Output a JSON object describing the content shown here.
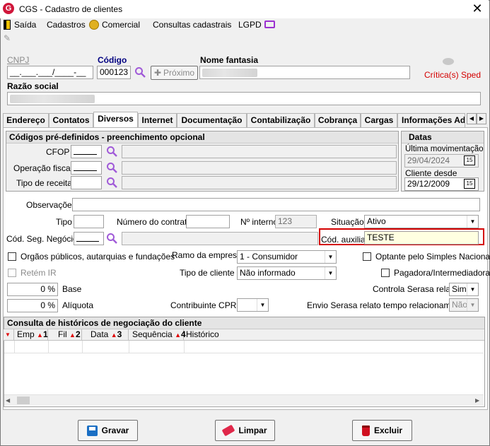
{
  "window": {
    "title": "CGS - Cadastro de clientes",
    "close": "✕"
  },
  "menu": {
    "saida": "Saída",
    "cadastros": "Cadastros",
    "comercial": "Comercial",
    "consultas": "Consultas cadastrais",
    "lgpd": "LGPD"
  },
  "header": {
    "cnpj_label": "CNPJ",
    "cnpj_value": "__.___.___/____-__",
    "codigo_label": "Código",
    "codigo_value": "000123",
    "proximo_label": "Próximo",
    "nome_fantasia_label": "Nome fantasia",
    "criticas_label": "Crítica(s) Sped",
    "razao_social_label": "Razão social"
  },
  "tabs": [
    "Endereço",
    "Contatos",
    "Diversos",
    "Internet",
    "Documentação",
    "Contabilização",
    "Cobrança",
    "Cargas",
    "Informações Adi"
  ],
  "codigos": {
    "title": "Códigos pré-definidos - preenchimento opcional",
    "cfop": "CFOP",
    "operacao": "Operação fiscal",
    "tipo_receita": "Tipo de receita"
  },
  "datas": {
    "title": "Datas",
    "ultima_label": "Última movimentação",
    "ultima_value": "29/04/2024",
    "cliente_desde_label": "Cliente desde",
    "cliente_desde_value": "29/12/2009",
    "cal_label": "15"
  },
  "form": {
    "observacoes": "Observações",
    "tipo": "Tipo",
    "numero_contrato": "Número do contrato",
    "n_interno": "Nº interno",
    "n_interno_value": "123",
    "situacao": "Situação",
    "situacao_value": "Ativo",
    "cod_seg": "Cód. Seg. Negócio",
    "cod_auxiliar": "Cód. auxiliar",
    "cod_auxiliar_value": "TESTE",
    "orgaos": "Orgãos públicos, autarquias e fundações",
    "ramo": "Ramo da empresa",
    "ramo_value": "1 - Consumidor",
    "optante": "Optante pelo Simples Nacional",
    "retem_ir": "Retém IR",
    "tipo_cliente": "Tipo de cliente",
    "tipo_cliente_value": "Não informado",
    "pagadora": "Pagadora/Intermediadora",
    "base_value": "0 %",
    "base": "Base",
    "controla_serasa": "Controla Serasa relato",
    "controla_serasa_value": "Sim",
    "aliquota_value": "0 %",
    "aliquota": "Alíquota",
    "contribuinte": "Contribuinte CPRB",
    "envio_serasa": "Envio Serasa relato tempo relacionamento",
    "envio_serasa_value": "Não"
  },
  "historico": {
    "title": "Consulta de históricos de negociação do cliente",
    "columns": [
      {
        "label": "Emp",
        "order": "1"
      },
      {
        "label": "Fil",
        "order": "2"
      },
      {
        "label": "Data",
        "order": "3"
      },
      {
        "label": "Sequência",
        "order": "4"
      },
      {
        "label": "Histórico",
        "order": ""
      }
    ]
  },
  "buttons": {
    "gravar": "Gravar",
    "limpar": "Limpar",
    "excluir": "Excluir"
  },
  "colors": {
    "accent_red": "#d0163a",
    "highlight_border": "#d40000",
    "highlight_bg": "#ffffe1",
    "mag": "#a05ad8"
  }
}
